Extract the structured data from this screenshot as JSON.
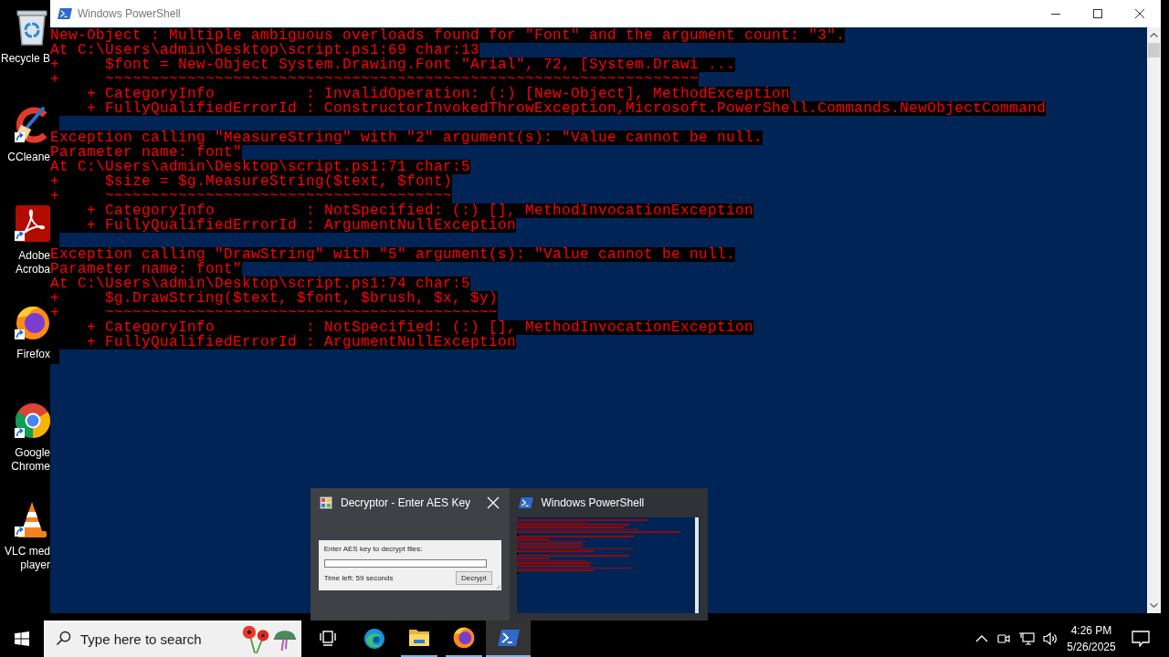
{
  "desktop_icons": [
    {
      "kind": "bin",
      "shortcut": false,
      "label": "Recycle B"
    },
    {
      "kind": "brush",
      "shortcut": true,
      "label": "CCleane"
    },
    {
      "kind": "acrobat",
      "shortcut": true,
      "label": "Adobe Acroba"
    },
    {
      "kind": "firefox",
      "shortcut": true,
      "label": "Firefox"
    },
    {
      "kind": "chrome",
      "shortcut": true,
      "label": "Google Chrome"
    },
    {
      "kind": "cone",
      "shortcut": true,
      "label": "VLC med player"
    }
  ],
  "window": {
    "title": "Windows PowerShell"
  },
  "console": {
    "lines": [
      {
        "kind": "text",
        "text": "New-Object : Multiple ambiguous overloads found for \"Font\" and the argument count: \"3\"."
      },
      {
        "kind": "text",
        "text": "At C:\\Users\\admin\\Desktop\\script.ps1:69 char:13"
      },
      {
        "kind": "text",
        "text": "+     $font = New-Object System.Drawing.Font \"Arial\", 72, [System.Drawi ..."
      },
      {
        "kind": "text",
        "text": "+     ~~~~~~~~~~~~~~~~~~~~~~~~~~~~~~~~~~~~~~~~~~~~~~~~~~~~~~~~~~~~~~~~~"
      },
      {
        "kind": "text",
        "text": "    + CategoryInfo          : InvalidOperation: (:) [New-Object], MethodException"
      },
      {
        "kind": "text",
        "text": "    + FullyQualifiedErrorId : ConstructorInvokedThrowException,Microsoft.PowerShell.Commands.NewObjectCommand"
      },
      {
        "kind": "blank"
      },
      {
        "kind": "text",
        "text": "Exception calling \"MeasureString\" with \"2\" argument(s): \"Value cannot be null."
      },
      {
        "kind": "text",
        "text": "Parameter name: font\""
      },
      {
        "kind": "text",
        "text": "At C:\\Users\\admin\\Desktop\\script.ps1:71 char:5"
      },
      {
        "kind": "text",
        "text": "+     $size = $g.MeasureString($text, $font)"
      },
      {
        "kind": "text",
        "text": "+     ~~~~~~~~~~~~~~~~~~~~~~~~~~~~~~~~~~~~~~"
      },
      {
        "kind": "text",
        "text": "    + CategoryInfo          : NotSpecified: (:) [], MethodInvocationException"
      },
      {
        "kind": "text",
        "text": "    + FullyQualifiedErrorId : ArgumentNullException"
      },
      {
        "kind": "blank"
      },
      {
        "kind": "text",
        "text": "Exception calling \"DrawString\" with \"5\" argument(s): \"Value cannot be null."
      },
      {
        "kind": "text",
        "text": "Parameter name: font\""
      },
      {
        "kind": "text",
        "text": "At C:\\Users\\admin\\Desktop\\script.ps1:74 char:5"
      },
      {
        "kind": "text",
        "text": "+     $g.DrawString($text, $font, $brush, $x, $y)"
      },
      {
        "kind": "text",
        "text": "+     ~~~~~~~~~~~~~~~~~~~~~~~~~~~~~~~~~~~~~~~~~~~"
      },
      {
        "kind": "text",
        "text": "    + CategoryInfo          : NotSpecified: (:) [], MethodInvocationException"
      },
      {
        "kind": "text",
        "text": "    + FullyQualifiedErrorId : ArgumentNullException"
      },
      {
        "kind": "blank"
      }
    ]
  },
  "taskbar": {
    "search": {
      "placeholder": "Type here to search"
    },
    "buttons": [
      {
        "kind": "task_view",
        "running": false,
        "selected": false
      },
      {
        "kind": "edge",
        "running": false,
        "selected": false
      },
      {
        "kind": "explorer",
        "running": true,
        "selected": false
      },
      {
        "kind": "firefox",
        "running": true,
        "selected": false
      },
      {
        "kind": "powershell",
        "running": true,
        "selected": true
      }
    ],
    "clock": {
      "time": "4:26 PM",
      "date": "5/26/2025"
    }
  },
  "taskbar_preview": {
    "windows": [
      {
        "kind": "dialog",
        "title": "Decryptor - Enter AES Key",
        "selected": true,
        "prompt": "Enter AES key to decrypt files:",
        "timer": "Time left: 59 seconds",
        "button": "Decrypt"
      },
      {
        "kind": "console",
        "title": "Windows PowerShell",
        "selected": false
      }
    ]
  }
}
